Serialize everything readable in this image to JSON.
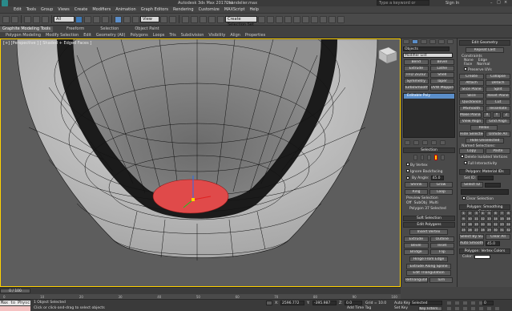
{
  "titlebar": {
    "title": "Autodesk 3ds Max 2017.rat",
    "file": "Chandelier.max",
    "search_placeholder": "Type a keyword or phrase",
    "signin": "Sign In"
  },
  "menubar": {
    "items": [
      "Edit",
      "Tools",
      "Group",
      "Views",
      "Create",
      "Modifiers",
      "Animation",
      "Graph Editors",
      "Rendering",
      "Customize",
      "MAXScript",
      "Help"
    ]
  },
  "toolbar": {
    "all_filter": "All",
    "view_dropdown": "View",
    "selection_set": "Create Selection Set"
  },
  "ribbon": {
    "tabs": [
      "Graphite Modeling Tools",
      "Freeform",
      "Selection",
      "Object Paint"
    ],
    "subtabs": [
      "Polygon Modeling",
      "Modify Selection",
      "Edit",
      "Geometry (All)",
      "Polygons",
      "Loops",
      "Tris",
      "Subdivision",
      "Visibility",
      "Align",
      "Properties"
    ]
  },
  "viewport": {
    "label": "[+] [Perspective ] [ Shaded + Edged Faces ]",
    "accent": "#ffd200",
    "selection_color": "#e04a4a"
  },
  "cmdpanel": {
    "object_name": "Objects",
    "modifier_list": "Modifier List",
    "buttons": [
      [
        "Bend",
        "Bevel"
      ],
      [
        "Extrude",
        "Lathe"
      ],
      [
        "FFD 2x2x2",
        "Shell"
      ],
      [
        "Symmetry",
        "Taper"
      ],
      [
        "TurboSmooth",
        "UVW Mapping Clr"
      ]
    ],
    "stack_item": "Editable Poly",
    "selection_title": "Selection",
    "by_vertex": "By Vertex",
    "ignore_backfacing": "Ignore Backfacing",
    "by_angle": "By Angle:",
    "angle_value": "45.0",
    "shrink": "Shrink",
    "grow": "Grow",
    "ring": "Ring",
    "loop": "Loop",
    "preview_selection": "Preview Selection",
    "off": "Off",
    "subobj": "SubObj",
    "multi": "Multi",
    "selected_info": "Polygon 37 Selected",
    "soft_selection": "Soft Selection",
    "edit_polygons": "Edit Polygons",
    "insert_vertex": "Insert Vertex",
    "poly_buttons": [
      [
        "Extrude",
        "Outline"
      ],
      [
        "Bevel",
        "Inset"
      ],
      [
        "Bridge",
        "Flip"
      ]
    ],
    "hinge": "Hinge From Edge",
    "extrude_spline": "Extrude Along Spline",
    "edit_triangulation": "Edit Triangulation",
    "retriangulate": "Retriangulate",
    "turn": "Turn"
  },
  "rightpanel": {
    "edit_geometry": "Edit Geometry",
    "repeat_last": "Repeat Last",
    "constraints": "Constraints",
    "none": "None",
    "edge": "Edge",
    "face": "Face",
    "normal": "Normal",
    "preserve_uvs": "Preserve UVs",
    "create": "Create",
    "collapse": "Collapse",
    "attach": "Attach",
    "detach": "Detach",
    "slice_plane": "Slice Plane",
    "split": "Split",
    "slice": "Slice",
    "reset_plane": "Reset Plane",
    "quickslice": "QuickSlice",
    "cut": "Cut",
    "msmooth": "MSmooth",
    "tessellate": "Tessellate",
    "make_planar": "Make Planar",
    "x": "X",
    "y": "Y",
    "z": "Z",
    "view_align": "View Align",
    "grid_align": "Grid Align",
    "relax": "Relax",
    "hide_selected": "Hide Selected",
    "unhide_all": "Unhide All",
    "hide_unselected": "Hide Unselected",
    "named_selections": "Named Selections:",
    "copy": "Copy",
    "paste": "Paste",
    "delete_isolated": "Delete Isolated Vertices",
    "full_interactivity": "Full Interactivity",
    "material_ids": "Polygon: Material IDs",
    "set_id": "Set ID:",
    "select_id": "Select ID",
    "clear_selection": "Clear Selection",
    "smoothing_groups": "Polygon: Smoothing Groups",
    "sg_numbers": [
      "1",
      "2",
      "3",
      "4",
      "5",
      "6",
      "7",
      "8",
      "9",
      "10",
      "11",
      "12",
      "13",
      "14",
      "15",
      "16",
      "17",
      "18",
      "19",
      "20",
      "21",
      "22",
      "23",
      "24",
      "25",
      "26",
      "27",
      "28",
      "29",
      "30",
      "31",
      "32"
    ],
    "select_by_sg": "Select By SG",
    "clear_all": "Clear All",
    "auto_smooth": "Auto Smooth",
    "auto_smooth_value": "45.0",
    "vertex_colors": "Polygon: Vertex Colors",
    "color": "Color:"
  },
  "timeline": {
    "frame": "0 / 100",
    "ticks": [
      "0",
      "10",
      "20",
      "30",
      "40",
      "50",
      "60",
      "70",
      "80",
      "90",
      "100"
    ]
  },
  "statusbar": {
    "listener": "Max to Physc",
    "objects_selected": "1 Object Selected",
    "prompt": "Click or click-and-drag to select objects",
    "x_label": "X:",
    "x_value": "2596.772",
    "y_label": "Y:",
    "y_value": "-395.987",
    "z_label": "Z:",
    "z_value": "0.0",
    "grid": "Grid = 10.0",
    "add_time_tag": "Add Time Tag",
    "auto_key": "Auto Key",
    "selected": "Selected",
    "set_key": "Set Key",
    "key_filters": "Key Filters...",
    "frame_value": "0"
  }
}
